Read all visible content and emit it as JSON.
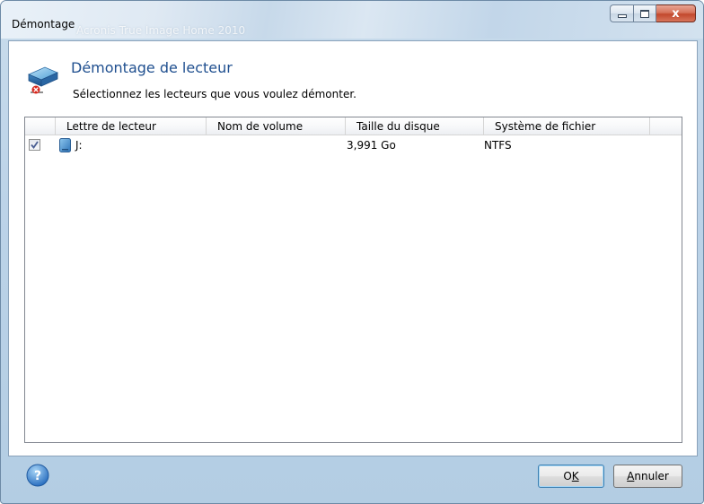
{
  "window": {
    "title": "Démontage",
    "ghost_title": "Acronis True Image Home 2010",
    "close_label": "x"
  },
  "header": {
    "title": "Démontage de lecteur",
    "subtitle": "Sélectionnez les lecteurs que vous voulez démonter."
  },
  "list": {
    "columns": [
      "Lettre de lecteur",
      "Nom de volume",
      "Taille du disque",
      "Système de fichier"
    ],
    "rows": [
      {
        "checked": true,
        "letter": "J:",
        "volume": "",
        "size": "3,991 Go",
        "filesystem": "NTFS"
      }
    ]
  },
  "buttons": {
    "ok_prefix": "O",
    "ok_mnemonic": "K",
    "cancel_mnemonic": "A",
    "cancel_rest": "nnuler"
  },
  "colors": {
    "accent_title": "#1f4f8f",
    "frame": "#b3cde3"
  },
  "icons": {
    "header": "unmount-drive-icon",
    "drive": "drive-icon",
    "help": "help-icon"
  }
}
